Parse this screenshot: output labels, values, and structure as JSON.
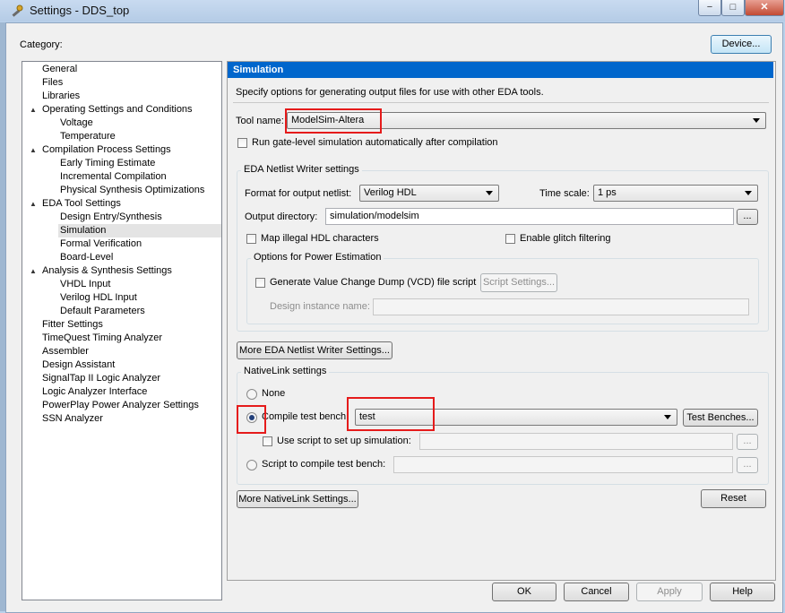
{
  "window": {
    "title": "Settings - DDS_top",
    "minimize": "−",
    "maximize": "□",
    "close": "✕"
  },
  "category_label": "Category:",
  "device_button": "Device...",
  "tree": [
    {
      "label": "General",
      "level": 0,
      "expander": ""
    },
    {
      "label": "Files",
      "level": 0,
      "expander": ""
    },
    {
      "label": "Libraries",
      "level": 0,
      "expander": ""
    },
    {
      "label": "Operating Settings and Conditions",
      "level": 0,
      "expander": "▲"
    },
    {
      "label": "Voltage",
      "level": 1,
      "expander": ""
    },
    {
      "label": "Temperature",
      "level": 1,
      "expander": ""
    },
    {
      "label": "Compilation Process Settings",
      "level": 0,
      "expander": "▲"
    },
    {
      "label": "Early Timing Estimate",
      "level": 1,
      "expander": ""
    },
    {
      "label": "Incremental Compilation",
      "level": 1,
      "expander": ""
    },
    {
      "label": "Physical Synthesis Optimizations",
      "level": 1,
      "expander": ""
    },
    {
      "label": "EDA Tool Settings",
      "level": 0,
      "expander": "▲"
    },
    {
      "label": "Design Entry/Synthesis",
      "level": 1,
      "expander": ""
    },
    {
      "label": "Simulation",
      "level": 1,
      "expander": "",
      "selected": true
    },
    {
      "label": "Formal Verification",
      "level": 1,
      "expander": ""
    },
    {
      "label": "Board-Level",
      "level": 1,
      "expander": ""
    },
    {
      "label": "Analysis & Synthesis Settings",
      "level": 0,
      "expander": "▲"
    },
    {
      "label": "VHDL Input",
      "level": 1,
      "expander": ""
    },
    {
      "label": "Verilog HDL Input",
      "level": 1,
      "expander": ""
    },
    {
      "label": "Default Parameters",
      "level": 1,
      "expander": ""
    },
    {
      "label": "Fitter Settings",
      "level": 0,
      "expander": ""
    },
    {
      "label": "TimeQuest Timing Analyzer",
      "level": 0,
      "expander": ""
    },
    {
      "label": "Assembler",
      "level": 0,
      "expander": ""
    },
    {
      "label": "Design Assistant",
      "level": 0,
      "expander": ""
    },
    {
      "label": "SignalTap II Logic Analyzer",
      "level": 0,
      "expander": ""
    },
    {
      "label": "Logic Analyzer Interface",
      "level": 0,
      "expander": ""
    },
    {
      "label": "PowerPlay Power Analyzer Settings",
      "level": 0,
      "expander": ""
    },
    {
      "label": "SSN Analyzer",
      "level": 0,
      "expander": ""
    }
  ],
  "panel": {
    "header": "Simulation",
    "description": "Specify options for generating output files for use with other EDA tools.",
    "tool_name_label": "Tool name:",
    "tool_name_value": "ModelSim-Altera",
    "run_gate_level_label": "Run gate-level simulation automatically after compilation",
    "run_gate_level_checked": false,
    "netlist_group_label": "EDA Netlist Writer settings",
    "format_label": "Format for output netlist:",
    "format_value": "Verilog HDL",
    "time_scale_label": "Time scale:",
    "time_scale_value": "1 ps",
    "output_dir_label": "Output directory:",
    "output_dir_value": "simulation/modelsim",
    "browse": "...",
    "map_illegal_label": "Map illegal HDL characters",
    "map_illegal_checked": false,
    "glitch_label": "Enable glitch filtering",
    "glitch_checked": false,
    "power_group_label": "Options for Power Estimation",
    "vcd_label": "Generate Value Change Dump (VCD) file script",
    "vcd_checked": false,
    "script_settings_button": "Script Settings...",
    "design_instance_label": "Design instance name:",
    "design_instance_value": "",
    "more_netlist_button": "More EDA Netlist Writer Settings...",
    "nativelink_group_label": "NativeLink settings",
    "none_label": "None",
    "compile_tb_label": "Compile test bench:",
    "compile_tb_value": "test",
    "test_benches_button": "Test Benches...",
    "use_script_label": "Use script to set up simulation:",
    "use_script_checked": false,
    "use_script_value": "",
    "script_compile_label": "Script to compile test bench:",
    "script_compile_value": "",
    "nativelink_selected": "compile_test_bench",
    "more_nativelink_button": "More NativeLink Settings...",
    "reset_button": "Reset"
  },
  "footer": {
    "ok": "OK",
    "cancel": "Cancel",
    "apply": "Apply",
    "help": "Help"
  },
  "colors": {
    "header_blue": "#0066cc",
    "highlight_red": "#e51b1b",
    "titlebar": "#b9d1ea"
  }
}
